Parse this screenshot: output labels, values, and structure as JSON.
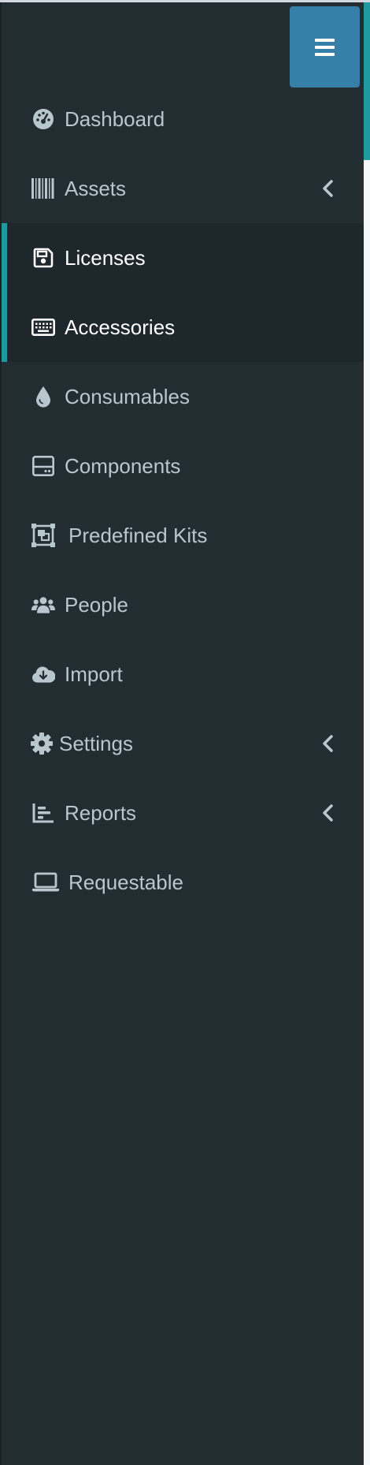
{
  "sidebar": {
    "toggle_label": "",
    "items": [
      {
        "label": "Dashboard",
        "icon": "tachometer-icon",
        "has_submenu": false,
        "active": false
      },
      {
        "label": "Assets",
        "icon": "barcode-icon",
        "has_submenu": true,
        "active": false
      },
      {
        "label": "Licenses",
        "icon": "save-icon",
        "has_submenu": false,
        "active": true
      },
      {
        "label": "Accessories",
        "icon": "keyboard-icon",
        "has_submenu": false,
        "active": true
      },
      {
        "label": "Consumables",
        "icon": "tint-icon",
        "has_submenu": false,
        "active": false
      },
      {
        "label": "Components",
        "icon": "hdd-icon",
        "has_submenu": false,
        "active": false
      },
      {
        "label": "Predefined Kits",
        "icon": "object-group-icon",
        "has_submenu": false,
        "active": false
      },
      {
        "label": "People",
        "icon": "users-icon",
        "has_submenu": false,
        "active": false
      },
      {
        "label": "Import",
        "icon": "cloud-download-icon",
        "has_submenu": false,
        "active": false
      },
      {
        "label": "Settings",
        "icon": "cog-icon",
        "has_submenu": true,
        "active": false
      },
      {
        "label": "Reports",
        "icon": "chart-bar-icon",
        "has_submenu": true,
        "active": false
      },
      {
        "label": "Requestable",
        "icon": "laptop-icon",
        "has_submenu": false,
        "active": false
      }
    ]
  },
  "colors": {
    "sidebar_bg": "#222d32",
    "active_bg": "#1e282c",
    "accent": "#1f9aa0",
    "toggle_bg": "#367fa9",
    "text": "#b8c7ce",
    "active_text": "#ffffff"
  }
}
